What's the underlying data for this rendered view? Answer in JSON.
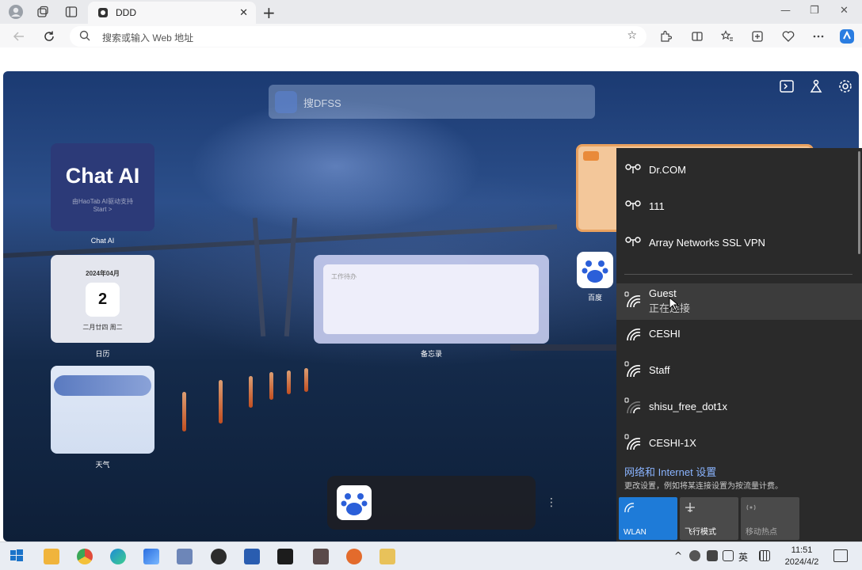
{
  "browser": {
    "tab_title": "DDD",
    "address_placeholder": "搜索或输入 Web 地址"
  },
  "page": {
    "search_placeholder": "搜DFSS",
    "chat_card": {
      "title": "Chat AI",
      "subtitle": "由HaoTab AI驱动支持",
      "start": "Start >",
      "label": "Chat AI"
    },
    "calendar_card": {
      "year_month": "2024年04月",
      "day": "2",
      "lunar": "二月廿四 周二",
      "label": "日历"
    },
    "weather_card": {
      "label": "天气"
    },
    "note_card": {
      "placeholder": "工作待办",
      "label": "备忘录"
    },
    "baidu_tile": {
      "label": "百度"
    }
  },
  "network_flyout": {
    "vpn_items": [
      {
        "name": "Dr.COM"
      },
      {
        "name": "111"
      },
      {
        "name": "Array Networks SSL VPN"
      }
    ],
    "wifi_items": [
      {
        "name": "Guest",
        "status": "正在连接"
      },
      {
        "name": "CESHI"
      },
      {
        "name": "Staff"
      },
      {
        "name": "shisu_free_dot1x"
      },
      {
        "name": "CESHI-1X"
      }
    ],
    "settings_link": "网络和 Internet 设置",
    "settings_desc": "更改设置，例如将某连接设置为按流量计费。",
    "quick_actions": [
      {
        "label": "WLAN",
        "color": "#1e7bd8"
      },
      {
        "label": "飞行模式",
        "color": "#4a4a4a"
      },
      {
        "label": "移动热点",
        "color": "#4a4a4a"
      }
    ]
  },
  "taskbar": {
    "ime": "英",
    "time": "11:51",
    "date": "2024/4/2"
  }
}
